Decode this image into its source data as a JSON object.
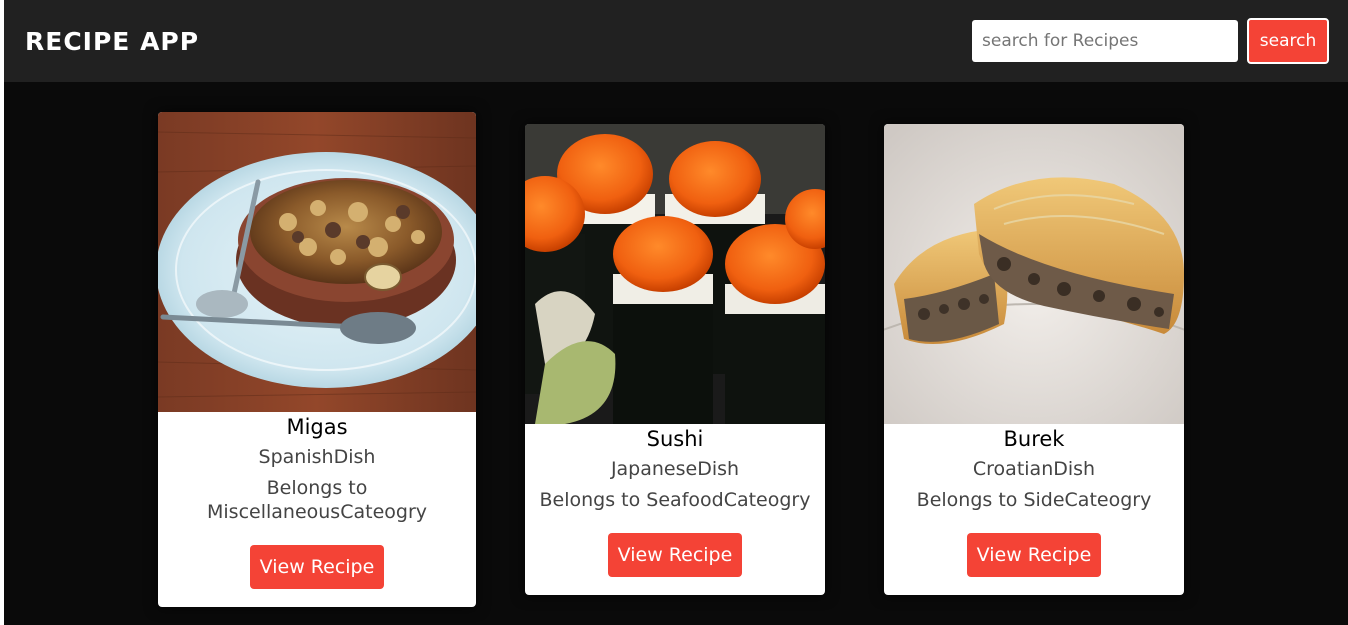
{
  "header": {
    "title": "RECIPE APP",
    "search_placeholder": "search for Recipes",
    "search_value": "",
    "search_button_label": "search"
  },
  "colors": {
    "accent": "#f44336",
    "header_bg": "#212121",
    "page_bg": "#0a0a0a"
  },
  "recipes": [
    {
      "name": "Migas",
      "area": "SpanishDish",
      "category": "Belongs to MiscellaneousCateogry",
      "button_label": "View Recipe",
      "image_desc": "bowl-of-migas-photo"
    },
    {
      "name": "Sushi",
      "area": "JapaneseDish",
      "category": "Belongs to SeafoodCateogry",
      "button_label": "View Recipe",
      "image_desc": "sushi-rolls-photo"
    },
    {
      "name": "Burek",
      "area": "CroatianDish",
      "category": "Belongs to SideCateogry",
      "button_label": "View Recipe",
      "image_desc": "burek-pastry-photo"
    }
  ]
}
